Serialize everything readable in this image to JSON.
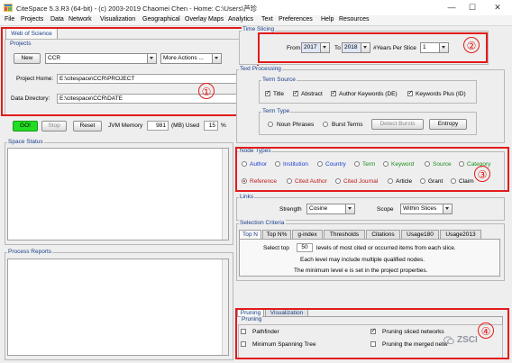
{
  "window": {
    "title": "CiteSpace 5.3.R3 (64-bit) - (c) 2003-2019 Chaomei Chen - Home: C:\\Users\\芦珍",
    "minimize": "—",
    "maximize": "☐",
    "close": "✕"
  },
  "menu": [
    "File",
    "Projects",
    "Data",
    "Network",
    "Visualization",
    "Geographical",
    "Overlay Maps",
    "Analytics",
    "Text",
    "Preferences",
    "Help",
    "Resources"
  ],
  "source_tab": "Web of Science",
  "projects": {
    "title": "Projects",
    "new_label": "New",
    "project_name": "CCR",
    "more_actions": "More Actions ...",
    "project_home_label": "Project Home:",
    "project_home_value": "E:\\citespace\\CCR\\PROJECT",
    "data_dir_label": "Data Directory:",
    "data_dir_value": "E:\\citespace\\CCR\\DATE"
  },
  "run": {
    "go": "GO!",
    "stop": "Stop",
    "reset": "Reset",
    "jvm_label": "JVM Memory",
    "jvm_value": "981",
    "used_label": "(MB) Used",
    "used_value": "15",
    "pct": "%"
  },
  "space_status": "Space Status",
  "process_reports": "Process Reports",
  "time_slicing": {
    "title": "Time Slicing",
    "from_label": "From",
    "from_value": "2017",
    "to_label": "To",
    "to_value": "2018",
    "years_label": "#Years Per Slice",
    "years_value": "1"
  },
  "text_processing": {
    "title": "Text Processing",
    "term_source": "Term Source",
    "sources": [
      {
        "label": "Title",
        "checked": true
      },
      {
        "label": "Abstract",
        "checked": true
      },
      {
        "label": "Author Keywords (DE)",
        "checked": true
      },
      {
        "label": "Keywords Plus (ID)",
        "checked": true
      }
    ],
    "term_type": "Term Type",
    "noun_phrases": "Noun Phrases",
    "burst_terms": "Burst Terms",
    "detect_bursts": "Detect Bursts",
    "entropy": "Entropy"
  },
  "node_types": {
    "title": "Node Types",
    "row1": [
      {
        "label": "Author",
        "color": "#1a3fd0"
      },
      {
        "label": "Institution",
        "color": "#1a3fd0"
      },
      {
        "label": "Country",
        "color": "#1a3fd0"
      },
      {
        "label": "Term",
        "color": "#1e8f1e"
      },
      {
        "label": "Keyword",
        "color": "#1e8f1e"
      },
      {
        "label": "Source",
        "color": "#1e8f1e"
      },
      {
        "label": "Category",
        "color": "#1e8f1e"
      }
    ],
    "row2": [
      {
        "label": "Reference",
        "color": "#c01818",
        "selected": true
      },
      {
        "label": "Cited Author",
        "color": "#c01818"
      },
      {
        "label": "Cited Journal",
        "color": "#c01818"
      },
      {
        "label": "Article",
        "color": "#222222"
      },
      {
        "label": "Grant",
        "color": "#222222"
      },
      {
        "label": "Claim",
        "color": "#222222"
      }
    ]
  },
  "links": {
    "title": "Links",
    "strength_label": "Strength",
    "strength_value": "Cosine",
    "scope_label": "Scope",
    "scope_value": "Within Slices"
  },
  "selection": {
    "title": "Selection Criteria",
    "tabs": [
      "Top N",
      "Top N%",
      "g-index",
      "Thresholds",
      "Citations",
      "Usage180",
      "Usage2013"
    ],
    "line1_pre": "Select top",
    "line1_value": "50",
    "line1_post": "levels of most cited or occurred items from each slice.",
    "line2": "Each level may include multiple qualified nodes.",
    "line3": "The minimum level e is set in the project properties."
  },
  "pruning": {
    "tabs": [
      "Pruning",
      "Visualization"
    ],
    "title": "Pruning",
    "items": [
      {
        "label": "Pathfinder",
        "checked": false
      },
      {
        "label": "Pruning sliced networks",
        "checked": true
      },
      {
        "label": "Minimum Spanning Tree",
        "checked": false
      },
      {
        "label": "Pruning the merged netw",
        "checked": false
      }
    ]
  },
  "annotations": [
    "①",
    "②",
    "③",
    "④"
  ],
  "watermark": "ZSCI",
  "colors": {
    "annotation": "#e21b1b",
    "go": "#22dd22",
    "title_blue": "#1a3f8a"
  }
}
